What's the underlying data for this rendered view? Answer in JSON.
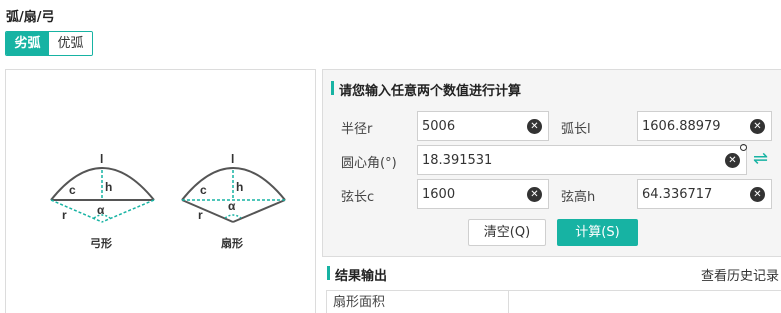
{
  "page": {
    "title": "弧/扇/弓"
  },
  "tabs": [
    {
      "label": "劣弧",
      "active": true
    },
    {
      "label": "优弧",
      "active": false
    }
  ],
  "diagram": {
    "segment": {
      "caption": "弓形",
      "l": "l",
      "h": "h",
      "c": "c",
      "r": "r",
      "alpha": "α"
    },
    "sector": {
      "caption": "扇形",
      "l": "l",
      "h": "h",
      "c": "c",
      "r": "r",
      "alpha": "α"
    }
  },
  "calculator": {
    "title": "请您输入任意两个数值进行计算",
    "radius": {
      "label": "半径r",
      "value": "5006"
    },
    "arc_length": {
      "label": "弧长l",
      "value": "1606.88979"
    },
    "central_angle": {
      "label": "圆心角(°)",
      "value": "18.391531"
    },
    "chord": {
      "label": "弦长c",
      "value": "1600"
    },
    "height": {
      "label": "弦高h",
      "value": "64.336717"
    },
    "clear_button": "清空(Q)",
    "calc_button": "计算(S)",
    "swap_icon": "⇌",
    "clear_icon": "✕"
  },
  "results": {
    "title": "结果输出",
    "history_link": "查看历史记录",
    "rows": [
      {
        "label": "扇形面积",
        "value": ""
      }
    ]
  },
  "colors": {
    "accent": "#17b3a3"
  }
}
